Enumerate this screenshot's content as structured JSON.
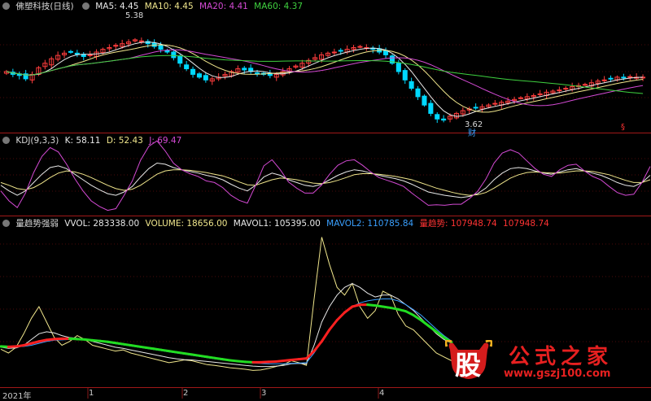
{
  "panels": {
    "price": {
      "legend": [
        {
          "text": "佛塑科技(日线)",
          "color": "#d8d8d8"
        },
        {
          "text": "MA5: 4.45",
          "color": "#e8e8e8"
        },
        {
          "text": "MA10: 4.45",
          "color": "#f0e68c"
        },
        {
          "text": "MA20: 4.41",
          "color": "#d44ad4"
        },
        {
          "text": "MA60: 4.37",
          "color": "#3fd13f"
        }
      ],
      "annotations": [
        {
          "text": "5.38",
          "color": "#d8d8d8"
        },
        {
          "text": "3.62",
          "color": "#d8d8d8"
        },
        {
          "text": "财",
          "color": "#3aa0ff"
        },
        {
          "text": "§",
          "color": "#ff3333"
        }
      ]
    },
    "kdj": {
      "legend": [
        {
          "text": "KDJ(9,3,3)",
          "color": "#d8d8d8"
        },
        {
          "text": "K: 58.11",
          "color": "#e8e8e8"
        },
        {
          "text": "D: 52.43",
          "color": "#f0e68c"
        },
        {
          "text": "J: 69.47",
          "color": "#d44ad4"
        }
      ]
    },
    "volume": {
      "legend": [
        {
          "text": "量趋势强弱",
          "color": "#d8d8d8"
        },
        {
          "text": "VVOL: 283338.00",
          "color": "#e8e8e8"
        },
        {
          "text": "VOLUME: 18656.00",
          "color": "#f0e68c"
        },
        {
          "text": "MAVOL1: 105395.00",
          "color": "#e8e8e8"
        },
        {
          "text": "MAVOL2: 110785.84",
          "color": "#3aa0ff"
        },
        {
          "text": "量趋势: 107948.74",
          "color": "#ff3333"
        },
        {
          "text": "107948.74",
          "color": "#ff3333"
        }
      ]
    }
  },
  "x_axis_labels": [
    "2021年",
    "1",
    "2",
    "3",
    "4"
  ],
  "watermark": {
    "logo_glyph": "股",
    "title": "公式之家",
    "url": "www.gszj100.com"
  },
  "colors": {
    "up": "#ff3d3d",
    "down": "#00d8ff",
    "ma5": "#e8e8e8",
    "ma10": "#f0e68c",
    "ma20": "#d44ad4",
    "ma60": "#3fd13f",
    "separator": "#a01818",
    "grid": "#4a0a0a",
    "trend_up": "#ff2020",
    "trend_down": "#22dd22",
    "mavol2": "#3aa0ff"
  },
  "chart_data": [
    {
      "type": "candlestick",
      "title": "佛塑科技(日线)",
      "price_high_label": 5.38,
      "price_low_label": 3.62,
      "ylim": [
        3.5,
        5.6
      ],
      "close": [
        4.55,
        4.5,
        4.48,
        4.42,
        4.5,
        4.62,
        4.7,
        4.78,
        4.84,
        4.88,
        4.9,
        4.86,
        4.82,
        4.85,
        4.9,
        4.95,
        4.98,
        5.02,
        5.05,
        5.08,
        5.12,
        5.1,
        5.05,
        5.0,
        4.95,
        4.9,
        4.8,
        4.7,
        4.6,
        4.5,
        4.45,
        4.4,
        4.42,
        4.45,
        4.5,
        4.55,
        4.6,
        4.58,
        4.55,
        4.52,
        4.5,
        4.48,
        4.5,
        4.55,
        4.6,
        4.65,
        4.7,
        4.75,
        4.8,
        4.85,
        4.88,
        4.9,
        4.92,
        4.95,
        4.98,
        5.0,
        4.98,
        4.95,
        4.9,
        4.85,
        4.7,
        4.55,
        4.4,
        4.25,
        4.1,
        3.95,
        3.8,
        3.7,
        3.68,
        3.75,
        3.8,
        3.85,
        3.88,
        3.9,
        3.92,
        3.95,
        3.98,
        4.0,
        4.02,
        4.05,
        4.08,
        4.1,
        4.12,
        4.15,
        4.18,
        4.2,
        4.22,
        4.25,
        4.28,
        4.3,
        4.32,
        4.35,
        4.38,
        4.4,
        4.42,
        4.45,
        4.44,
        4.46,
        4.45,
        4.45
      ],
      "ma5_last": 4.45,
      "ma10_last": 4.45,
      "ma20_last": 4.41,
      "ma60_last": 4.37
    },
    {
      "type": "line",
      "title": "KDJ(9,3,3)",
      "ylim": [
        -10,
        110
      ],
      "series": [
        {
          "name": "K",
          "values": [
            40,
            30,
            22,
            30,
            45,
            60,
            72,
            75,
            70,
            60,
            50,
            40,
            32,
            25,
            22,
            28,
            38,
            55,
            70,
            80,
            78,
            72,
            68,
            65,
            62,
            58,
            55,
            50,
            42,
            35,
            30,
            40,
            55,
            62,
            58,
            50,
            45,
            40,
            38,
            42,
            50,
            58,
            64,
            68,
            66,
            62,
            58,
            55,
            52,
            48,
            42,
            35,
            28,
            25,
            22,
            20,
            18,
            20,
            25,
            35,
            50,
            62,
            70,
            72,
            70,
            66,
            62,
            60,
            64,
            68,
            70,
            66,
            62,
            58,
            52,
            45,
            40,
            38,
            45,
            58
          ]
        },
        {
          "name": "D",
          "values": [
            45,
            40,
            34,
            32,
            36,
            44,
            54,
            62,
            66,
            64,
            60,
            54,
            47,
            40,
            34,
            31,
            33,
            40,
            50,
            60,
            66,
            68,
            68,
            67,
            65,
            63,
            60,
            57,
            52,
            46,
            41,
            40,
            45,
            50,
            53,
            52,
            50,
            47,
            44,
            43,
            45,
            49,
            54,
            59,
            61,
            61,
            60,
            58,
            56,
            53,
            50,
            45,
            40,
            35,
            31,
            27,
            24,
            22,
            23,
            27,
            35,
            44,
            53,
            59,
            63,
            64,
            63,
            62,
            62,
            64,
            66,
            66,
            65,
            62,
            59,
            54,
            49,
            45,
            45,
            50
          ]
        },
        {
          "name": "J",
          "values": [
            30,
            12,
            0,
            26,
            63,
            92,
            108,
            100,
            78,
            52,
            30,
            12,
            2,
            -5,
            -2,
            22,
            48,
            85,
            110,
            120,
            102,
            80,
            68,
            61,
            56,
            48,
            45,
            36,
            22,
            13,
            8,
            40,
            75,
            86,
            68,
            46,
            35,
            26,
            26,
            40,
            60,
            76,
            84,
            86,
            76,
            64,
            54,
            49,
            44,
            38,
            26,
            15,
            4,
            5,
            4,
            6,
            6,
            16,
            29,
            51,
            80,
            98,
            104,
            98,
            84,
            70,
            60,
            56,
            68,
            76,
            78,
            66,
            56,
            50,
            38,
            27,
            22,
            24,
            45,
            74
          ]
        }
      ]
    },
    {
      "type": "line",
      "title": "量趋势强弱",
      "series": [
        {
          "name": "VOLUME",
          "values": [
            90000,
            80000,
            95000,
            130000,
            170000,
            200000,
            160000,
            120000,
            100000,
            110000,
            125000,
            115000,
            100000,
            95000,
            90000,
            85000,
            88000,
            80000,
            75000,
            70000,
            65000,
            60000,
            55000,
            58000,
            62000,
            60000,
            55000,
            50000,
            48000,
            45000,
            42000,
            40000,
            38000,
            35000,
            36000,
            40000,
            45000,
            50000,
            60000,
            55000,
            48000,
            220000,
            380000,
            310000,
            250000,
            230000,
            260000,
            200000,
            170000,
            190000,
            240000,
            230000,
            180000,
            150000,
            140000,
            120000,
            100000,
            80000,
            70000,
            60000
          ]
        },
        {
          "name": "MAVOL1",
          "values": [
            95000,
            92000,
            93000,
            100000,
            115000,
            130000,
            135000,
            132000,
            125000,
            120000,
            118000,
            115000,
            110000,
            105000,
            100000,
            95000,
            92000,
            88000,
            84000,
            80000,
            76000,
            72000,
            68000,
            65000,
            63000,
            62000,
            60000,
            58000,
            56000,
            54000,
            52000,
            50000,
            48000,
            46000,
            45000,
            45000,
            46000,
            48000,
            52000,
            53000,
            52000,
            100000,
            160000,
            200000,
            230000,
            250000,
            260000,
            250000,
            235000,
            225000,
            230000,
            230000,
            220000,
            205000,
            190000,
            170000,
            150000,
            130000,
            115000,
            105395
          ]
        },
        {
          "name": "MAVOL2",
          "values": [
            98000,
            97000,
            96000,
            97000,
            100000,
            105000,
            110000,
            113000,
            114000,
            115000,
            115000,
            114000,
            112000,
            110000,
            107000,
            104000,
            101000,
            98000,
            95000,
            92000,
            89000,
            86000,
            83000,
            80000,
            77000,
            74000,
            71000,
            68000,
            65000,
            62000,
            60000,
            58000,
            56000,
            54000,
            53000,
            52000,
            52000,
            52000,
            53000,
            54000,
            55000,
            80000,
            110000,
            140000,
            165000,
            185000,
            200000,
            210000,
            215000,
            218000,
            220000,
            220000,
            215000,
            205000,
            192000,
            178000,
            160000,
            142000,
            125000,
            110786
          ]
        },
        {
          "name": "量趋势",
          "values": [
            97000,
            96000,
            97000,
            100000,
            105000,
            110000,
            114000,
            116000,
            117000,
            117000,
            116000,
            115000,
            113000,
            111000,
            109000,
            106000,
            103000,
            100000,
            97000,
            94000,
            91000,
            88000,
            85000,
            82000,
            79000,
            76000,
            73000,
            70000,
            67000,
            64000,
            61000,
            59000,
            57000,
            56000,
            56000,
            57000,
            58000,
            60000,
            62000,
            64000,
            66000,
            85000,
            110000,
            140000,
            165000,
            185000,
            200000,
            205000,
            205000,
            203000,
            200000,
            197000,
            193000,
            188000,
            178000,
            165000,
            150000,
            135000,
            120000,
            107949
          ]
        }
      ]
    }
  ]
}
